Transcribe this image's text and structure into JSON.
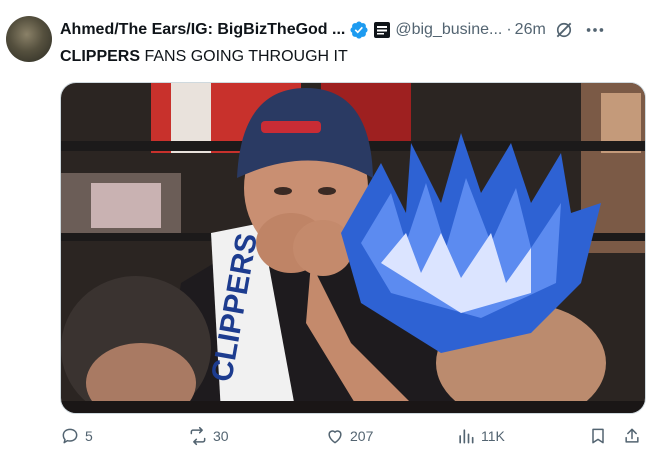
{
  "author": {
    "display_name": "Ahmed/The Ears/IG: BigBizTheGod ...",
    "handle": "@big_busine...",
    "time": "26m",
    "separator": "·"
  },
  "tweet": {
    "text_bold": "CLIPPERS",
    "text_rest": " FANS GOING THROUGH IT"
  },
  "image": {
    "alt": "Clippers fans looking upset in the stands",
    "jersey_text": "CLIPPERS"
  },
  "actions": {
    "replies": "5",
    "reposts": "30",
    "likes": "207",
    "views": "11K"
  },
  "colors": {
    "verified": "#1d9bf0",
    "muted": "#536471",
    "text": "#0f1419"
  },
  "icons": [
    "verified-badge-icon",
    "affiliate-badge-icon",
    "grok-icon",
    "more-icon",
    "reply-icon",
    "repost-icon",
    "like-icon",
    "views-icon",
    "bookmark-icon",
    "share-icon"
  ]
}
